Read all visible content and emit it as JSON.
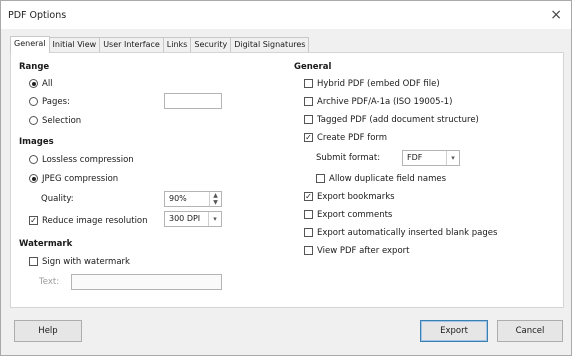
{
  "window": {
    "title": "PDF Options",
    "close_glyph": "×"
  },
  "tabs": [
    {
      "label": "General",
      "active": true
    },
    {
      "label": "Initial View"
    },
    {
      "label": "User Interface"
    },
    {
      "label": "Links"
    },
    {
      "label": "Security"
    },
    {
      "label": "Digital Signatures"
    }
  ],
  "range": {
    "heading": "Range",
    "all": "All",
    "pages": "Pages:",
    "pages_value": "",
    "selection": "Selection",
    "selected": "all"
  },
  "images": {
    "heading": "Images",
    "lossless": "Lossless compression",
    "jpeg": "JPEG compression",
    "selected": "jpeg",
    "quality_label": "Quality:",
    "quality_value": "90%",
    "reduce_label": "Reduce image resolution",
    "reduce_checked": true,
    "resolution_value": "300 DPI"
  },
  "watermark": {
    "heading": "Watermark",
    "sign_label": "Sign with watermark",
    "sign_checked": false,
    "text_label": "Text:",
    "text_value": ""
  },
  "general": {
    "heading": "General",
    "options": [
      {
        "label": "Hybrid PDF (embed ODF file)",
        "checked": false
      },
      {
        "label": "Archive PDF/A-1a (ISO 19005-1)",
        "checked": false
      },
      {
        "label": "Tagged PDF (add document structure)",
        "checked": false
      },
      {
        "label": "Create PDF form",
        "checked": true
      }
    ],
    "submit_format_label": "Submit format:",
    "submit_format_value": "FDF",
    "allow_duplicate": {
      "label": "Allow duplicate field names",
      "checked": false
    },
    "more_options": [
      {
        "label": "Export bookmarks",
        "checked": true
      },
      {
        "label": "Export comments",
        "checked": false
      },
      {
        "label": "Export automatically inserted blank pages",
        "checked": false
      },
      {
        "label": "View PDF after export",
        "checked": false
      }
    ]
  },
  "buttons": {
    "help": "Help",
    "export": "Export",
    "cancel": "Cancel"
  },
  "icons": {
    "check": "check-icon",
    "spin": "spin-arrows-icon",
    "dropdown": "chevron-down-icon"
  }
}
